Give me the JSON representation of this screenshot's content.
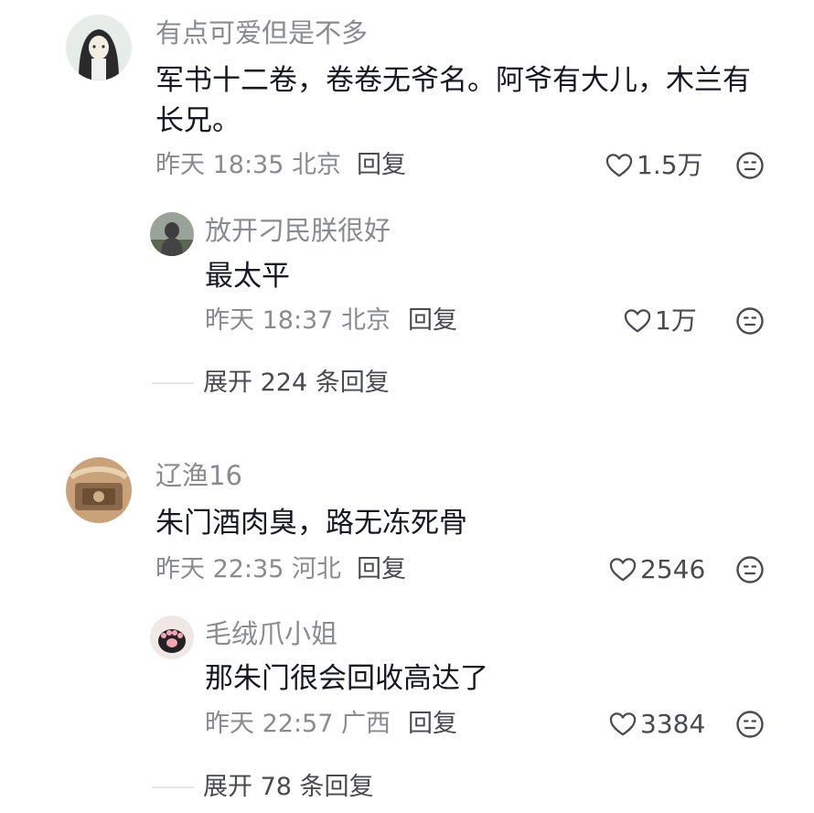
{
  "comments": [
    {
      "username": "有点可爱但是不多",
      "text": " 军书十二卷，卷卷无爷名。阿爷有大儿，木兰有长兄。",
      "meta": "昨天 18:35 北京",
      "reply_label": "回复",
      "likes": "1.5万",
      "reply": {
        "username": "放开刁民朕很好",
        "text": "最太平",
        "meta": "昨天 18:37 北京",
        "reply_label": "回复",
        "likes": "1万"
      },
      "expand": "展开 224 条回复"
    },
    {
      "username": "辽渔16",
      "text": "朱门酒肉臭，路无冻死骨",
      "meta": "昨天 22:35 河北",
      "reply_label": "回复",
      "likes": "2546",
      "reply": {
        "username": "毛绒爪小姐",
        "text": "那朱门很会回收高达了",
        "meta": "昨天 22:57 广西",
        "reply_label": "回复",
        "likes": "3384"
      },
      "expand": "展开 78 条回复"
    }
  ],
  "icons": {
    "like": "heart-outline-icon",
    "dislike": "meh-face-icon"
  },
  "colors": {
    "text": "#161823",
    "secondary": "#8a8b91",
    "action": "#4a4b52"
  }
}
